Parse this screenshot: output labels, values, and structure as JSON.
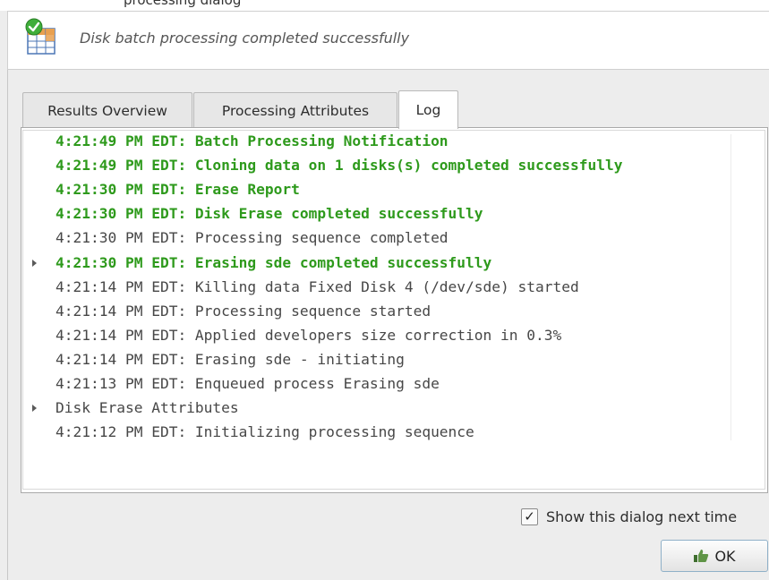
{
  "window": {
    "title_fragment": "processing dialog"
  },
  "header": {
    "icon": "batch-complete-icon",
    "message": "Disk batch processing completed successfully"
  },
  "tabs": [
    {
      "label": "Results Overview",
      "active": false
    },
    {
      "label": "Processing Attributes",
      "active": false
    },
    {
      "label": "Log",
      "active": true
    }
  ],
  "log": {
    "lines": [
      {
        "text": "4:21:49 PM EDT: Batch Processing Notification",
        "status": "success",
        "expandable": false
      },
      {
        "text": "4:21:49 PM EDT: Cloning data on 1 disks(s) completed successfully",
        "status": "success",
        "expandable": false
      },
      {
        "text": "4:21:30 PM EDT: Erase Report",
        "status": "success",
        "expandable": false
      },
      {
        "text": "4:21:30 PM EDT: Disk Erase completed successfully",
        "status": "success",
        "expandable": false
      },
      {
        "text": "4:21:30 PM EDT: Processing sequence completed",
        "status": "info",
        "expandable": false
      },
      {
        "text": "4:21:30 PM EDT: Erasing sde completed successfully",
        "status": "success",
        "expandable": true
      },
      {
        "text": "4:21:14 PM EDT: Killing data Fixed Disk 4 (/dev/sde) started",
        "status": "info",
        "expandable": false
      },
      {
        "text": "4:21:14 PM EDT: Processing sequence started",
        "status": "info",
        "expandable": false
      },
      {
        "text": "4:21:14 PM EDT: Applied developers size correction in 0.3%",
        "status": "info",
        "expandable": false
      },
      {
        "text": "4:21:14 PM EDT: Erasing sde - initiating",
        "status": "info",
        "expandable": false
      },
      {
        "text": "4:21:13 PM EDT: Enqueued process Erasing sde",
        "status": "info",
        "expandable": false
      },
      {
        "text": "Disk Erase Attributes",
        "status": "info",
        "expandable": true
      },
      {
        "text": "4:21:12 PM EDT: Initializing processing sequence",
        "status": "info",
        "expandable": false
      }
    ]
  },
  "footer": {
    "show_again_checked": true,
    "show_again_label": "Show this dialog next time",
    "ok_label": "OK",
    "ok_icon": "thumbs-up-icon"
  },
  "colors": {
    "success": "#2e9a1c",
    "info": "#474747",
    "accent_border": "#8fb0c8"
  }
}
